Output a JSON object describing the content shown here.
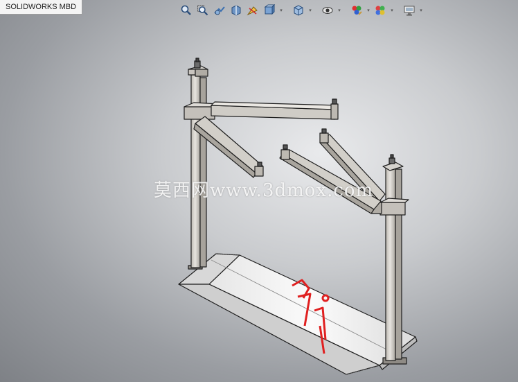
{
  "window": {
    "tab_label": "SOLIDWORKS MBD"
  },
  "heads_up_toolbar": {
    "buttons": [
      {
        "name": "zoom-to-fit",
        "icon": "zoom-fit-icon"
      },
      {
        "name": "zoom-to-area",
        "icon": "zoom-area-icon"
      },
      {
        "name": "previous-view",
        "icon": "previous-view-icon"
      },
      {
        "name": "section-view",
        "icon": "section-view-icon"
      },
      {
        "name": "dynamic-annotation",
        "icon": "annotation-icon"
      },
      {
        "name": "view-orientation",
        "icon": "view-orientation-icon",
        "dropdown": true
      },
      {
        "name": "display-style",
        "icon": "display-style-icon",
        "dropdown": true
      },
      {
        "name": "hide-show-items",
        "icon": "eye-icon",
        "dropdown": true
      },
      {
        "name": "edit-appearance",
        "icon": "appearance-icon",
        "dropdown": true
      },
      {
        "name": "apply-scene",
        "icon": "scene-icon",
        "dropdown": true
      },
      {
        "name": "view-settings",
        "icon": "monitor-icon",
        "dropdown": true
      }
    ]
  },
  "watermark": {
    "text": "莫西网www.3dmox.com"
  },
  "colors": {
    "frame_metal": "#d4d1cc",
    "frame_edge": "#1e1e1e",
    "ramp_surface": "#f2f2f2",
    "decal_red": "#e02020"
  }
}
